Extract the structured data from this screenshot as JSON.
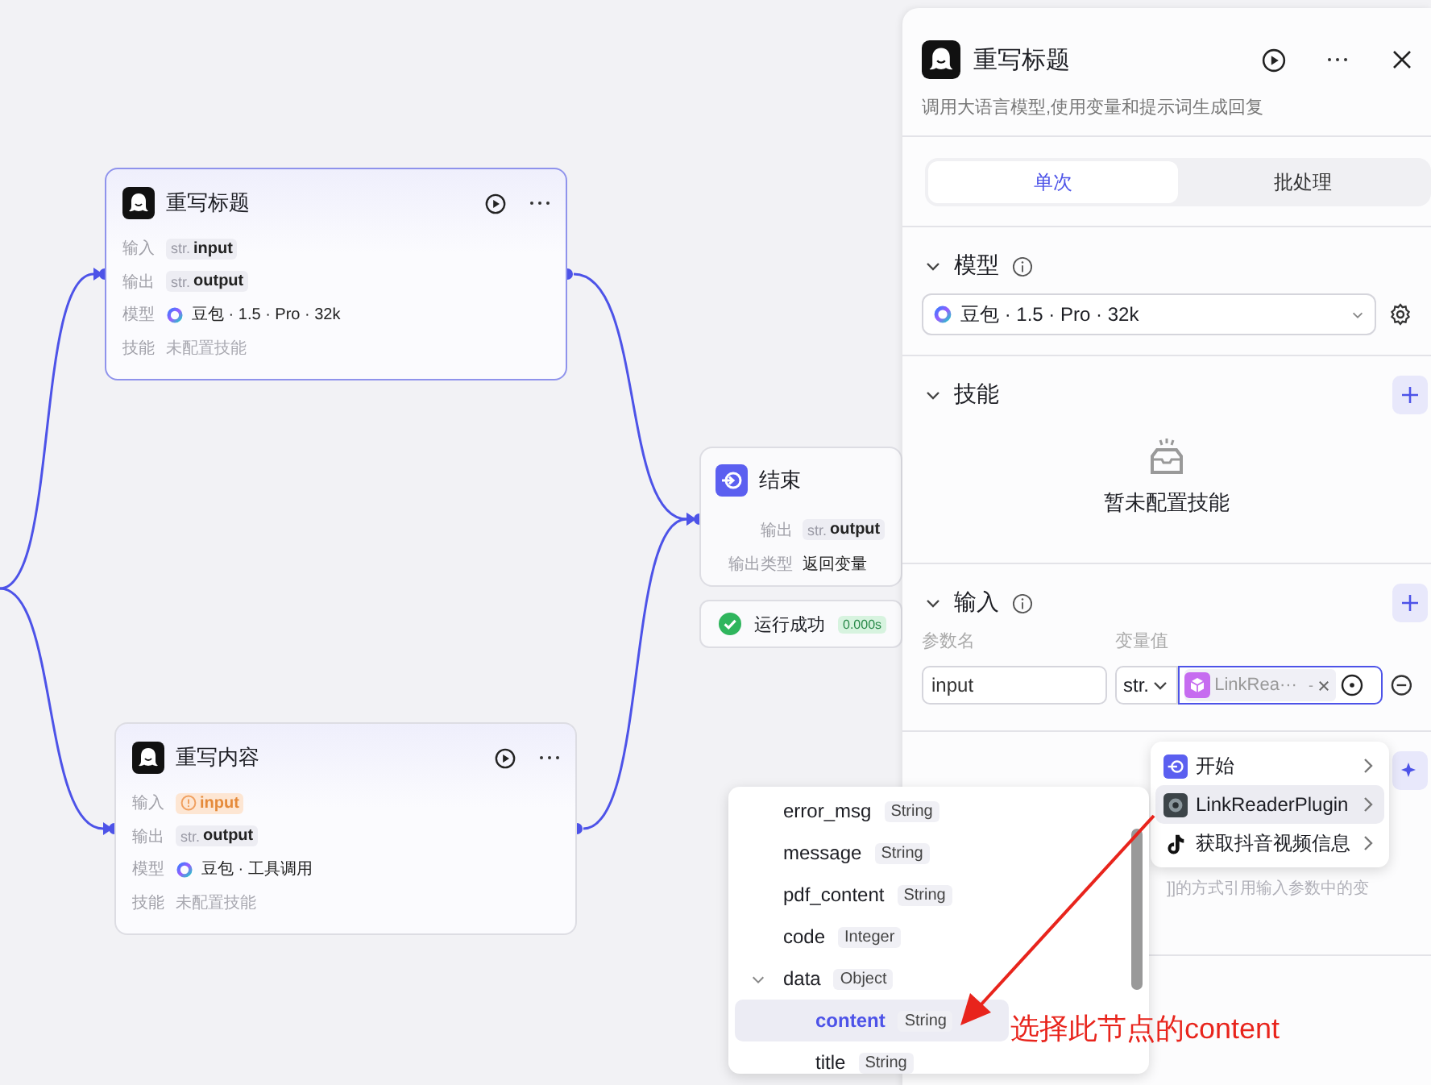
{
  "canvas": {
    "llm_nodes": [
      {
        "title": "重写标题",
        "selected": true,
        "rows": [
          {
            "label": "输入",
            "kind": "var",
            "type": "str.",
            "value": "input",
            "warning": false
          },
          {
            "label": "输出",
            "kind": "var",
            "type": "str.",
            "value": "output",
            "warning": false
          },
          {
            "label": "模型",
            "kind": "model",
            "value": "豆包 · 1.5 · Pro · 32k"
          },
          {
            "label": "技能",
            "kind": "text",
            "value": "未配置技能"
          }
        ]
      },
      {
        "title": "重写内容",
        "selected": false,
        "rows": [
          {
            "label": "输入",
            "kind": "var",
            "value": "input",
            "warning": true
          },
          {
            "label": "输出",
            "kind": "var",
            "type": "str.",
            "value": "output",
            "warning": false
          },
          {
            "label": "模型",
            "kind": "model",
            "value": "豆包 · 工具调用"
          },
          {
            "label": "技能",
            "kind": "text",
            "value": "未配置技能"
          }
        ]
      }
    ],
    "end_node": {
      "title": "结束",
      "rows": [
        {
          "label": "输出",
          "type": "str.",
          "value": "output"
        },
        {
          "label": "输出类型",
          "value": "返回变量"
        }
      ]
    },
    "run_status": {
      "text": "运行成功",
      "time": "0.000s",
      "success": true
    }
  },
  "panel": {
    "title": "重写标题",
    "description": "调用大语言模型,使用变量和提示词生成回复",
    "tabs": [
      {
        "label": "单次",
        "selected": true
      },
      {
        "label": "批处理",
        "selected": false
      }
    ],
    "model": {
      "title": "模型",
      "value": "豆包 · 1.5 · Pro · 32k"
    },
    "skills": {
      "title": "技能",
      "empty_text": "暂未配置技能"
    },
    "inputs": {
      "title": "输入",
      "columns": [
        "参数名",
        "变量值"
      ],
      "rows": [
        {
          "name": "input",
          "type": "str.",
          "ref": "LinkRea···",
          "ref_suffix": "-"
        }
      ]
    },
    "prompt_hint": "]]的方式引用输入参数中的变"
  },
  "source_menu": [
    {
      "label": "开始",
      "kind": "start",
      "selected": false
    },
    {
      "label": "LinkReaderPlugin",
      "kind": "plugin",
      "selected": true
    },
    {
      "label": "获取抖音视频信息",
      "kind": "video",
      "selected": false
    }
  ],
  "var_picker": {
    "items": [
      {
        "name": "error_msg",
        "type": "String",
        "selected": false
      },
      {
        "name": "message",
        "type": "String",
        "selected": false
      },
      {
        "name": "pdf_content",
        "type": "String",
        "selected": false
      },
      {
        "name": "code",
        "type": "Integer",
        "selected": false
      },
      {
        "name": "data",
        "type": "Object",
        "selected": false,
        "expanded": true,
        "children": [
          {
            "name": "content",
            "type": "String",
            "selected": true
          },
          {
            "name": "title",
            "type": "String",
            "selected": false
          }
        ]
      }
    ]
  },
  "annotation": {
    "text": "选择此节点的content"
  }
}
